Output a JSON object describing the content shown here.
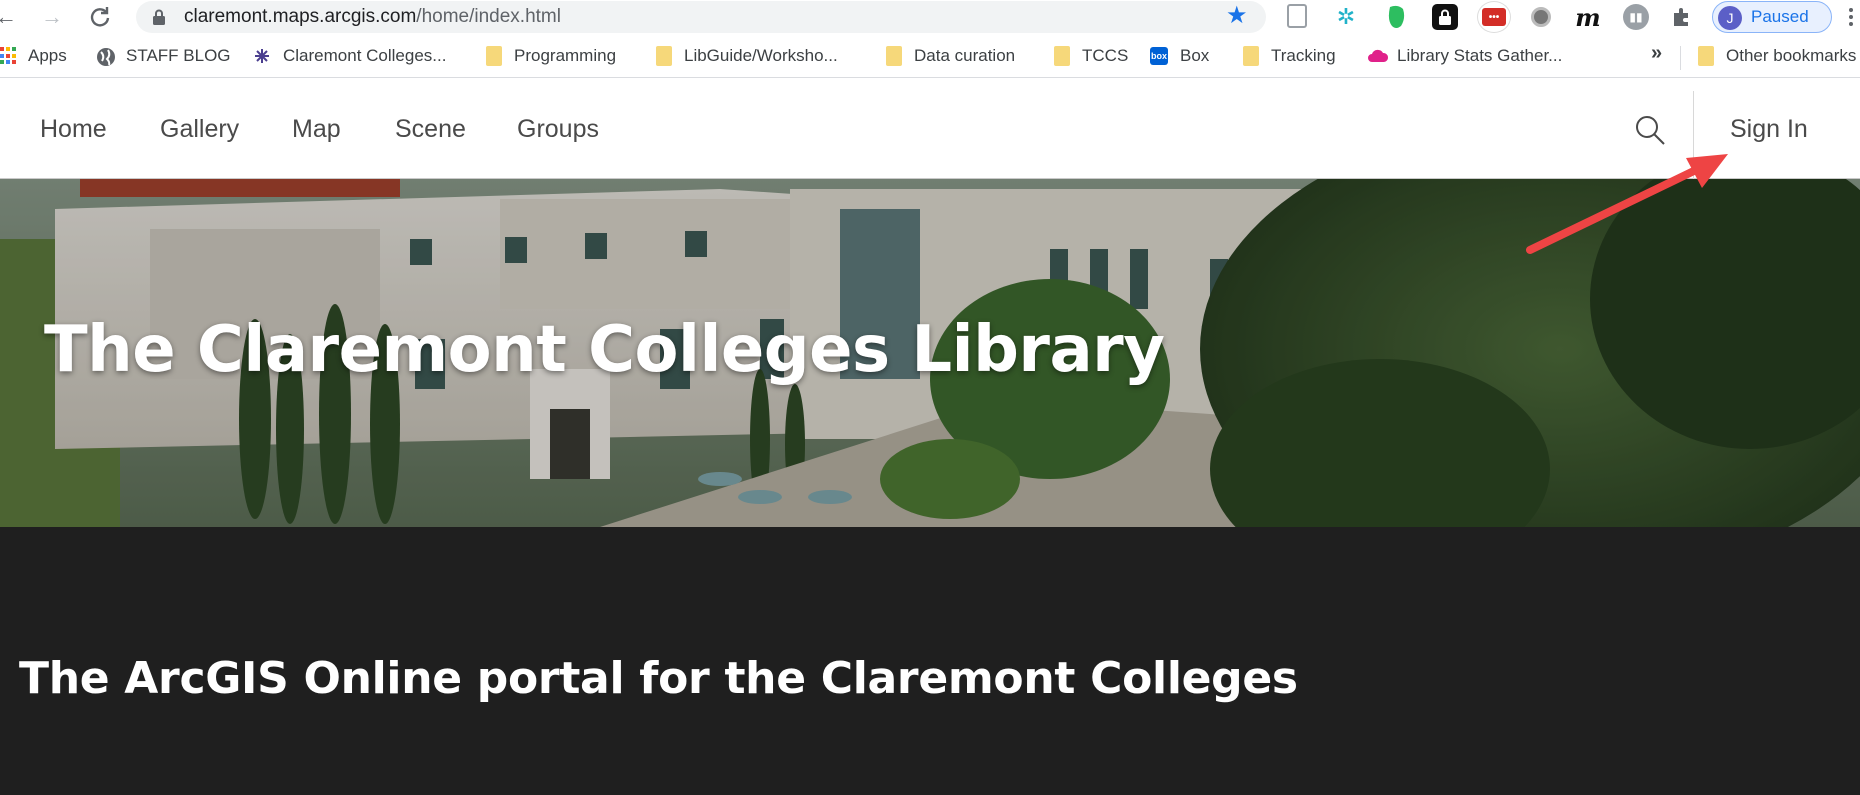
{
  "browser": {
    "url_host": "claremont.maps.arcgis.com",
    "url_path": "/home/index.html",
    "profile_initial": "J",
    "profile_status": "Paused",
    "colors": {
      "accent": "#1a73e8",
      "omnibox": "#f1f3f4"
    }
  },
  "bookmarks": {
    "items": [
      {
        "label": "Apps",
        "icon": "apps-grid-icon"
      },
      {
        "label": "STAFF BLOG",
        "icon": "globe-icon"
      },
      {
        "label": "Claremont Colleges...",
        "icon": "claremont-logo-icon"
      },
      {
        "label": "Programming",
        "icon": "folder-icon"
      },
      {
        "label": "LibGuide/Worksho...",
        "icon": "folder-icon"
      },
      {
        "label": "Data curation",
        "icon": "folder-icon"
      },
      {
        "label": "TCCS",
        "icon": "folder-icon"
      },
      {
        "label": "Box",
        "icon": "box-icon"
      },
      {
        "label": "Tracking",
        "icon": "folder-icon"
      },
      {
        "label": "Library Stats Gather...",
        "icon": "cloud-icon"
      }
    ],
    "overflow": "»",
    "other": "Other bookmarks"
  },
  "site": {
    "nav": [
      "Home",
      "Gallery",
      "Map",
      "Scene",
      "Groups"
    ],
    "sign_in": "Sign In",
    "hero_title": "The Claremont Colleges Library",
    "subtitle": "The ArcGIS Online portal for the Claremont Colleges",
    "colors": {
      "dark_band": "#1f1f1f",
      "annotation_arrow": "#ee4444"
    }
  }
}
